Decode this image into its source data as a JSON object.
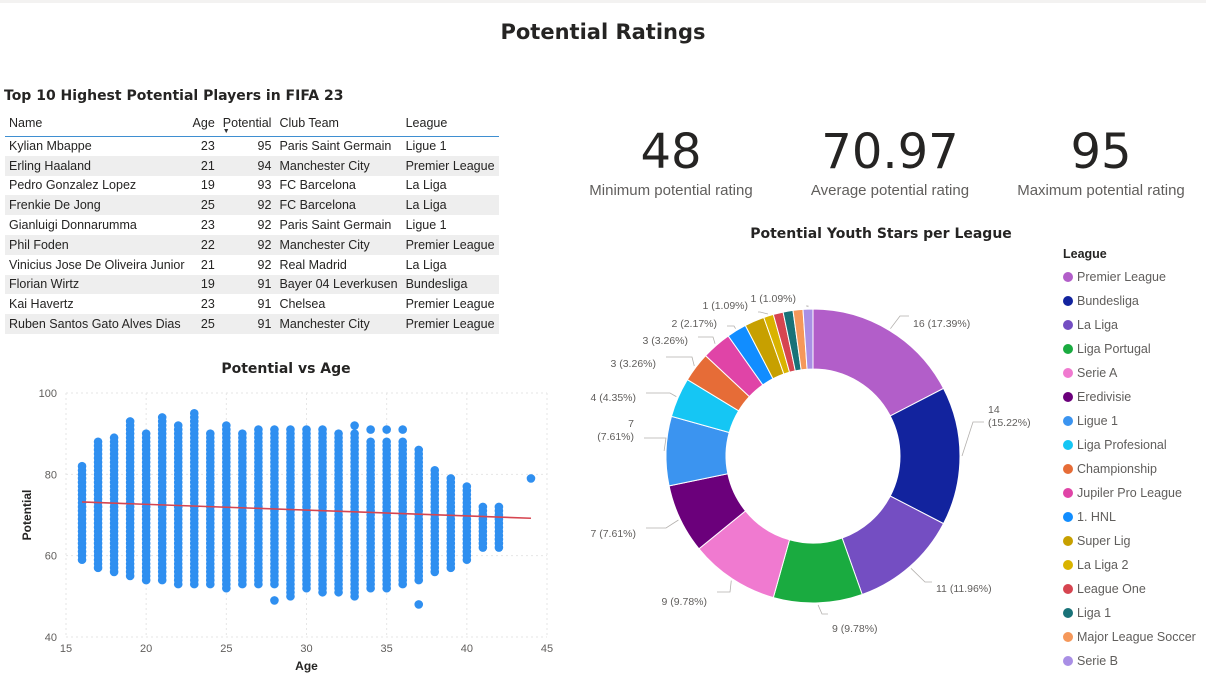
{
  "page": {
    "title": "Potential Ratings"
  },
  "table": {
    "title": "Top 10 Highest Potential Players in FIFA 23",
    "columns": [
      "Name",
      "Age",
      "Potential",
      "Club Team",
      "League"
    ],
    "rows": [
      [
        "Kylian Mbappe",
        "23",
        "95",
        "Paris Saint Germain",
        "Ligue 1"
      ],
      [
        "Erling Haaland",
        "21",
        "94",
        "Manchester City",
        "Premier League"
      ],
      [
        "Pedro Gonzalez Lopez",
        "19",
        "93",
        "FC Barcelona",
        "La Liga"
      ],
      [
        "Frenkie De Jong",
        "25",
        "92",
        "FC Barcelona",
        "La Liga"
      ],
      [
        "Gianluigi Donnarumma",
        "23",
        "92",
        "Paris Saint Germain",
        "Ligue 1"
      ],
      [
        "Phil Foden",
        "22",
        "92",
        "Manchester City",
        "Premier League"
      ],
      [
        "Vinicius Jose De Oliveira Junior",
        "21",
        "92",
        "Real Madrid",
        "La Liga"
      ],
      [
        "Florian Wirtz",
        "19",
        "91",
        "Bayer 04 Leverkusen",
        "Bundesliga"
      ],
      [
        "Kai Havertz",
        "23",
        "91",
        "Chelsea",
        "Premier League"
      ],
      [
        "Ruben Santos Gato Alves Dias",
        "25",
        "91",
        "Manchester City",
        "Premier League"
      ]
    ]
  },
  "kpis": [
    {
      "value": "48",
      "label": "Minimum potential rating"
    },
    {
      "value": "70.97",
      "label": "Average potential rating"
    },
    {
      "value": "95",
      "label": "Maximum potential rating"
    }
  ],
  "chart_data": [
    {
      "type": "scatter",
      "title": "Potential vs Age",
      "xlabel": "Age",
      "ylabel": "Potential",
      "xlim": [
        15,
        45
      ],
      "ylim": [
        40,
        100
      ],
      "xticks": [
        15,
        20,
        25,
        30,
        35,
        40,
        45
      ],
      "yticks": [
        40,
        60,
        80,
        100
      ],
      "grid": true,
      "color": "#2f8ff0",
      "trend_color": "#d64550",
      "trendline": {
        "x": [
          16,
          44
        ],
        "y": [
          73.2,
          69.2
        ]
      },
      "age_ranges": [
        {
          "age": 16,
          "min": 59,
          "max": 82
        },
        {
          "age": 17,
          "min": 57,
          "max": 88
        },
        {
          "age": 18,
          "min": 56,
          "max": 89
        },
        {
          "age": 19,
          "min": 55,
          "max": 93
        },
        {
          "age": 20,
          "min": 54,
          "max": 90
        },
        {
          "age": 21,
          "min": 54,
          "max": 94
        },
        {
          "age": 22,
          "min": 53,
          "max": 92
        },
        {
          "age": 23,
          "min": 53,
          "max": 95
        },
        {
          "age": 24,
          "min": 53,
          "max": 90
        },
        {
          "age": 25,
          "min": 52,
          "max": 92
        },
        {
          "age": 26,
          "min": 53,
          "max": 90
        },
        {
          "age": 27,
          "min": 53,
          "max": 91
        },
        {
          "age": 28,
          "min": 53,
          "max": 91
        },
        {
          "age": 29,
          "min": 50,
          "max": 91
        },
        {
          "age": 30,
          "min": 52,
          "max": 91
        },
        {
          "age": 31,
          "min": 51,
          "max": 91
        },
        {
          "age": 32,
          "min": 51,
          "max": 90
        },
        {
          "age": 33,
          "min": 50,
          "max": 90
        },
        {
          "age": 34,
          "min": 52,
          "max": 88
        },
        {
          "age": 35,
          "min": 52,
          "max": 88
        },
        {
          "age": 36,
          "min": 53,
          "max": 88
        },
        {
          "age": 37,
          "min": 54,
          "max": 86
        },
        {
          "age": 38,
          "min": 56,
          "max": 81
        },
        {
          "age": 39,
          "min": 57,
          "max": 79
        },
        {
          "age": 40,
          "min": 59,
          "max": 77
        },
        {
          "age": 41,
          "min": 62,
          "max": 72
        },
        {
          "age": 42,
          "min": 62,
          "max": 72
        }
      ],
      "outliers": [
        {
          "x": 28,
          "y": 49
        },
        {
          "x": 37,
          "y": 48
        },
        {
          "x": 44,
          "y": 79
        },
        {
          "x": 36,
          "y": 91
        },
        {
          "x": 35,
          "y": 91
        },
        {
          "x": 34,
          "y": 91
        },
        {
          "x": 33,
          "y": 92
        }
      ]
    },
    {
      "type": "pie",
      "donut": true,
      "title": "Potential Youth Stars per League",
      "legend_title": "League",
      "legend_position": "right",
      "slices": [
        {
          "label": "Premier League",
          "value": 16,
          "display": "16 (17.39%)",
          "color": "#b25ec9"
        },
        {
          "label": "Bundesliga",
          "value": 14,
          "display": "14 (15.22%)",
          "color": "#12239e"
        },
        {
          "label": "La Liga",
          "value": 11,
          "display": "11 (11.96%)",
          "color": "#744ec2"
        },
        {
          "label": "Liga Portugal",
          "value": 9,
          "display": "9 (9.78%)",
          "color": "#1aab40"
        },
        {
          "label": "Serie A",
          "value": 9,
          "display": "9 (9.78%)",
          "color": "#f07ad0"
        },
        {
          "label": "Eredivisie",
          "value": 7,
          "display": "7 (7.61%)",
          "color": "#6b007b"
        },
        {
          "label": "Ligue 1",
          "value": 7,
          "display": "7 (7.61%)",
          "color": "#3b94f0"
        },
        {
          "label": "Liga Profesional",
          "value": 4,
          "display": "4 (4.35%)",
          "color": "#15c6f4"
        },
        {
          "label": "Championship",
          "value": 3,
          "display": "3 (3.26%)",
          "color": "#e66c37"
        },
        {
          "label": "Jupiler Pro League",
          "value": 3,
          "display": "3 (3.26%)",
          "color": "#e044a7"
        },
        {
          "label": "1. HNL",
          "value": 2,
          "display": "2 (2.17%)",
          "color": "#118dff"
        },
        {
          "label": "Super Lig",
          "value": 2,
          "display": "",
          "color": "#c7a000"
        },
        {
          "label": "La Liga 2",
          "value": 1,
          "display": "1 (1.09%)",
          "color": "#d9b300"
        },
        {
          "label": "League One",
          "value": 1,
          "display": "",
          "color": "#d64550"
        },
        {
          "label": "Liga 1",
          "value": 1,
          "display": "",
          "color": "#197278"
        },
        {
          "label": "Major League Soccer",
          "value": 1,
          "display": "",
          "color": "#f5985a"
        },
        {
          "label": "Serie B",
          "value": 1,
          "display": "1 (1.09%)",
          "color": "#a98fe5"
        }
      ]
    }
  ]
}
